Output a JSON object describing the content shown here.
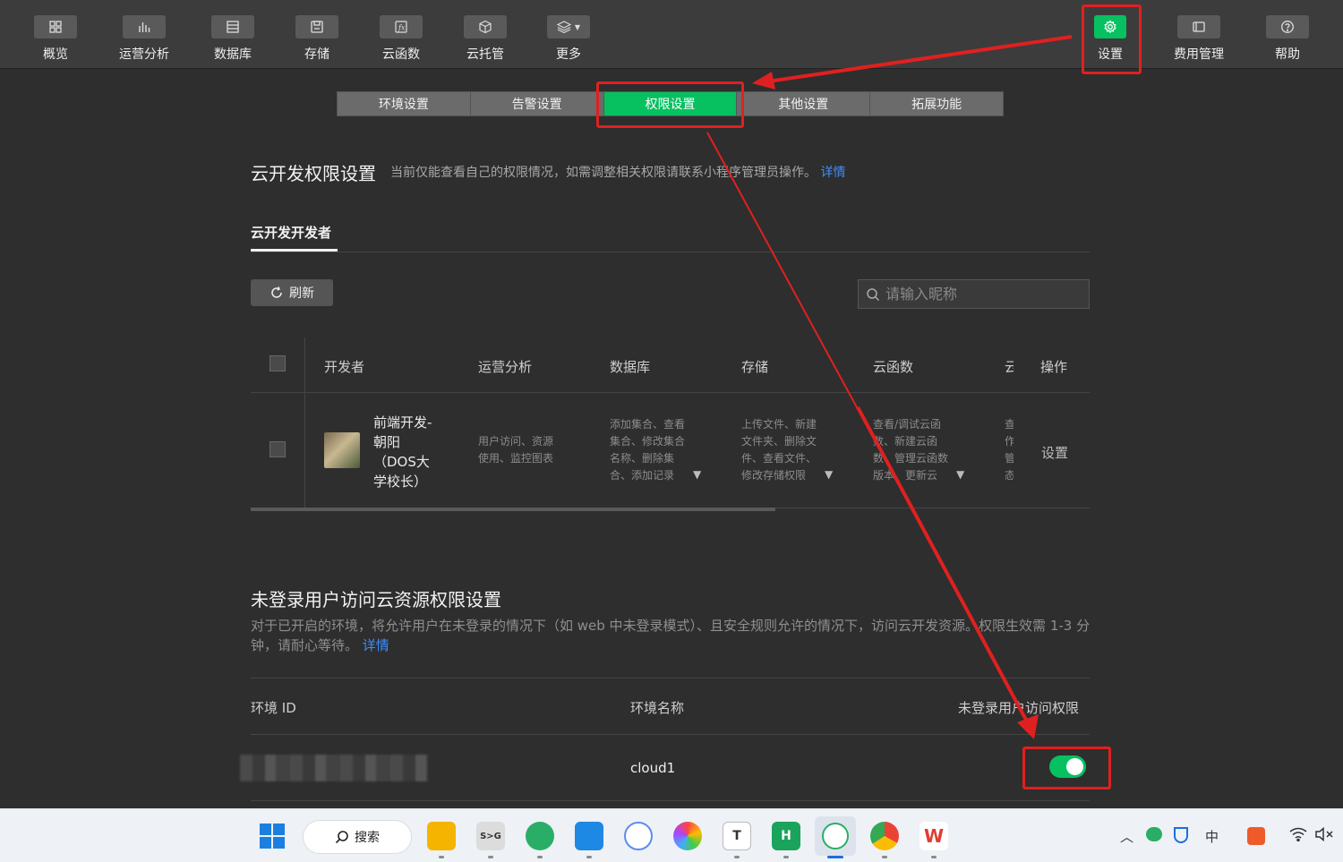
{
  "toolbar": {
    "left_items": [
      {
        "label": "概览",
        "icon": "overview-grid-icon"
      },
      {
        "label": "运营分析",
        "icon": "bar-chart-icon"
      },
      {
        "label": "数据库",
        "icon": "database-icon"
      },
      {
        "label": "存储",
        "icon": "storage-disk-icon"
      },
      {
        "label": "云函数",
        "icon": "function-icon"
      },
      {
        "label": "云托管",
        "icon": "cube-icon"
      },
      {
        "label": "更多",
        "icon": "layers-icon"
      }
    ],
    "right_items": [
      {
        "label": "设置",
        "icon": "gear-icon",
        "active": true
      },
      {
        "label": "费用管理",
        "icon": "billing-icon"
      },
      {
        "label": "帮助",
        "icon": "help-icon"
      }
    ]
  },
  "subtabs": [
    "环境设置",
    "告警设置",
    "权限设置",
    "其他设置",
    "拓展功能"
  ],
  "active_subtab": "权限设置",
  "permission": {
    "title": "云开发权限设置",
    "hint": "当前仅能查看自己的权限情况，如需调整相关权限请联系小程序管理员操作。",
    "hint_link": "详情",
    "tab": "云开发开发者",
    "refresh": "刷新",
    "search_placeholder": "请输入昵称",
    "headers": [
      "开发者",
      "运营分析",
      "数据库",
      "存储",
      "云函数",
      "云",
      "操作"
    ],
    "row": {
      "name_lines": [
        "前端开发-",
        "朝阳",
        "（DOS大",
        "学校长）"
      ],
      "ops_analysis": [
        "用户访问、资源",
        "使用、监控图表"
      ],
      "database": [
        "添加集合、查看",
        "集合、修改集合",
        "名称、删除集",
        "合、添加记录"
      ],
      "storage": [
        "上传文件、新建",
        "文件夹、删除文",
        "件、查看文件、",
        "修改存储权限"
      ],
      "functions": [
        "查看/调试云函",
        "数、新建云函",
        "数、管理云函数",
        "版本、更新云"
      ],
      "cloud_hosting": [
        "查",
        "作",
        "管",
        "态"
      ],
      "action": "设置"
    }
  },
  "anonymous": {
    "title": "未登录用户访问云资源权限设置",
    "desc": "对于已开启的环境，将允许用户在未登录的情况下（如 web 中未登录模式）、且安全规则允许的情况下，访问云开发资源。权限生效需 1-3 分钟，请耐心等待。",
    "desc_link": "详情",
    "headers": [
      "环境 ID",
      "环境名称",
      "未登录用户访问权限"
    ],
    "env_name": "cloud1",
    "toggle_on": true
  },
  "taskbar": {
    "search_label": "搜索",
    "tray": [
      "中"
    ],
    "apps": [
      "windows-start-icon",
      "file-explorer-icon",
      "terminal-icon",
      "wechat-icon",
      "vscode-icon",
      "app-icon",
      "color-wheel-icon",
      "typora-icon",
      "hbuilder-icon",
      "wechat-devtools-icon",
      "chrome-icon",
      "wps-icon"
    ]
  },
  "colors": {
    "accent": "#07c160",
    "annotation": "#e02020",
    "link": "#3d8eff"
  }
}
